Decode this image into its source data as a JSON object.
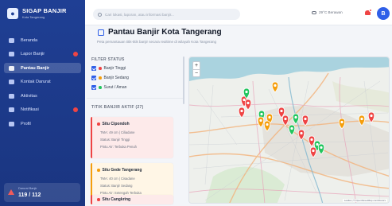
{
  "app": {
    "name": "SIGAP BANJIR",
    "subtitle": "Kota Tangerang"
  },
  "sidebar": {
    "items": [
      {
        "label": "Beranda",
        "icon": "home-icon",
        "active": false,
        "badge": false
      },
      {
        "label": "Lapor Banjir",
        "icon": "camera-icon",
        "active": false,
        "badge": true
      },
      {
        "label": "Pantau Banjir",
        "icon": "map-icon",
        "active": true,
        "badge": false
      },
      {
        "label": "Kontak Darurat",
        "icon": "phone-icon",
        "active": false,
        "badge": false
      },
      {
        "label": "Aktivitas",
        "icon": "activity-icon",
        "active": false,
        "badge": false
      },
      {
        "label": "Notifikasi",
        "icon": "bell-icon",
        "active": false,
        "badge": true
      },
      {
        "label": "Profil",
        "icon": "user-icon",
        "active": false,
        "badge": false
      }
    ],
    "footer": {
      "label": "Darurat Banjir",
      "value": "119 / 112"
    }
  },
  "topbar": {
    "search_placeholder": "Cari lokasi, laporan, atau informasi banjir...",
    "weather": "29°C Berawan",
    "avatar_initial": "B"
  },
  "page": {
    "title": "Pantau Banjir Kota Tangerang",
    "subtitle": "Peta pemantauan titik-titik banjir secara realtime di wilayah Kota Tangerang"
  },
  "filters": {
    "title": "FILTER STATUS",
    "items": [
      {
        "label": "Banjir Tinggi",
        "color": "#ef4444"
      },
      {
        "label": "Banjir Sedang",
        "color": "#f59e0b"
      },
      {
        "label": "Surut / Aman",
        "color": "#22c55e"
      }
    ]
  },
  "active_points": {
    "title": "TITIK BANJIR AKTIF (27)",
    "cards": [
      {
        "name": "Situ Cipondoh",
        "level": "TMA: 49 cm | Ciliadane",
        "status": "Status: Banjir Tinggi",
        "access": "Pintu Air: Terbuka Penuh",
        "color": "#ef4444",
        "bg": "#fdeaea"
      },
      {
        "name": "Situ Gede Tangerang",
        "level": "TMA: 40 cm | Cisadane",
        "status": "Status: Banjir Sedang",
        "access": "Pintu Air: Setengah Terbuka",
        "color": "#f59e0b",
        "bg": "#fff6e6"
      },
      {
        "name": "Situ Cangkring",
        "level": "",
        "status": "",
        "access": "",
        "color": "#ef4444",
        "bg": "#fdeaea"
      }
    ]
  },
  "map": {
    "zoom_in": "+",
    "zoom_out": "−",
    "attribution": "Leaflet | © OpenStreetMap contributors",
    "markers": [
      {
        "status": "tinggi"
      },
      {
        "status": "tinggi"
      },
      {
        "status": "tinggi"
      },
      {
        "status": "aman"
      },
      {
        "status": "sedang"
      },
      {
        "status": "aman"
      },
      {
        "status": "sedang"
      },
      {
        "status": "tinggi"
      },
      {
        "status": "tinggi"
      },
      {
        "status": "sedang"
      },
      {
        "status": "sedang"
      },
      {
        "status": "aman"
      },
      {
        "status": "tinggi"
      },
      {
        "status": "aman"
      },
      {
        "status": "tinggi"
      },
      {
        "status": "tinggi"
      },
      {
        "status": "aman"
      },
      {
        "status": "aman"
      },
      {
        "status": "tinggi"
      },
      {
        "status": "sedang"
      },
      {
        "status": "sedang"
      },
      {
        "status": "tinggi"
      }
    ]
  },
  "colors": {
    "primary": "#1f3f94",
    "accent": "#2f5fe8",
    "high": "#ef4444",
    "medium": "#f59e0b",
    "safe": "#22c55e"
  }
}
